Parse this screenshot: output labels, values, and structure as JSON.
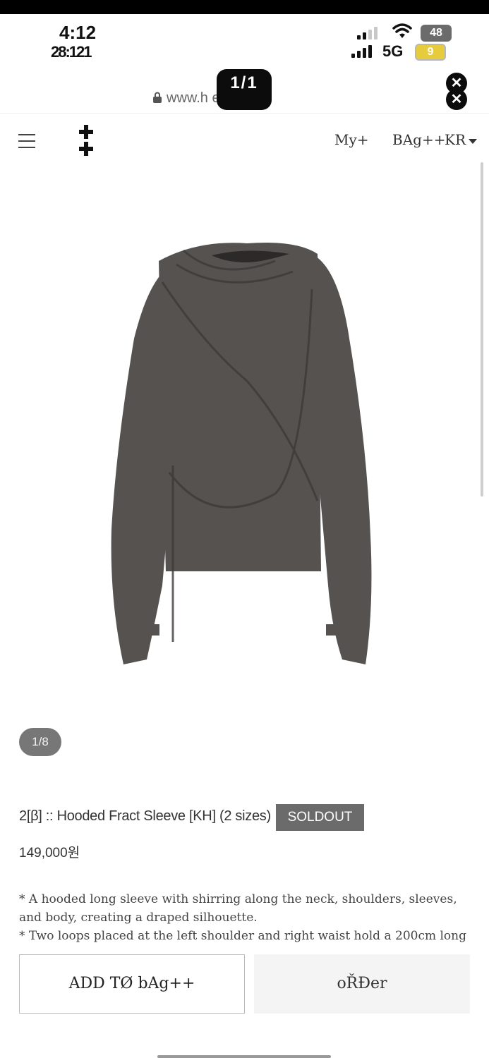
{
  "status_bar": {
    "time": "4:12",
    "time_secondary": "28:121",
    "network": "5G",
    "battery_top": "48",
    "battery_bottom": "9"
  },
  "browser": {
    "url": "www.h        emn.com",
    "image_counter": "1/1",
    "close_icon": "close-icon"
  },
  "nav": {
    "menu_icon": "hamburger-icon",
    "logo_icon": "plus-logo-icon",
    "my_label": "My+",
    "bag_label": "BAg++",
    "lang_label": "KR"
  },
  "gallery": {
    "pager": "1/8"
  },
  "product": {
    "title": "2[β] :: Hooded Fract Sleeve [KH] (2 sizes)",
    "badge": "SOLDOUT",
    "price": "149,000원",
    "description": [
      "* A hooded long sleeve with shirring along the neck, shoulders, sleeves, and body, creating a draped silhouette.",
      "* Two loops placed at the left shoulder and right waist hold a 200cm long"
    ]
  },
  "actions": {
    "add_to_bag": "ADD TØ bAg++",
    "order": "oŘĐer"
  },
  "colors": {
    "shirt": "#555250",
    "badge": "#6b6b6b",
    "pager": "#777777"
  }
}
